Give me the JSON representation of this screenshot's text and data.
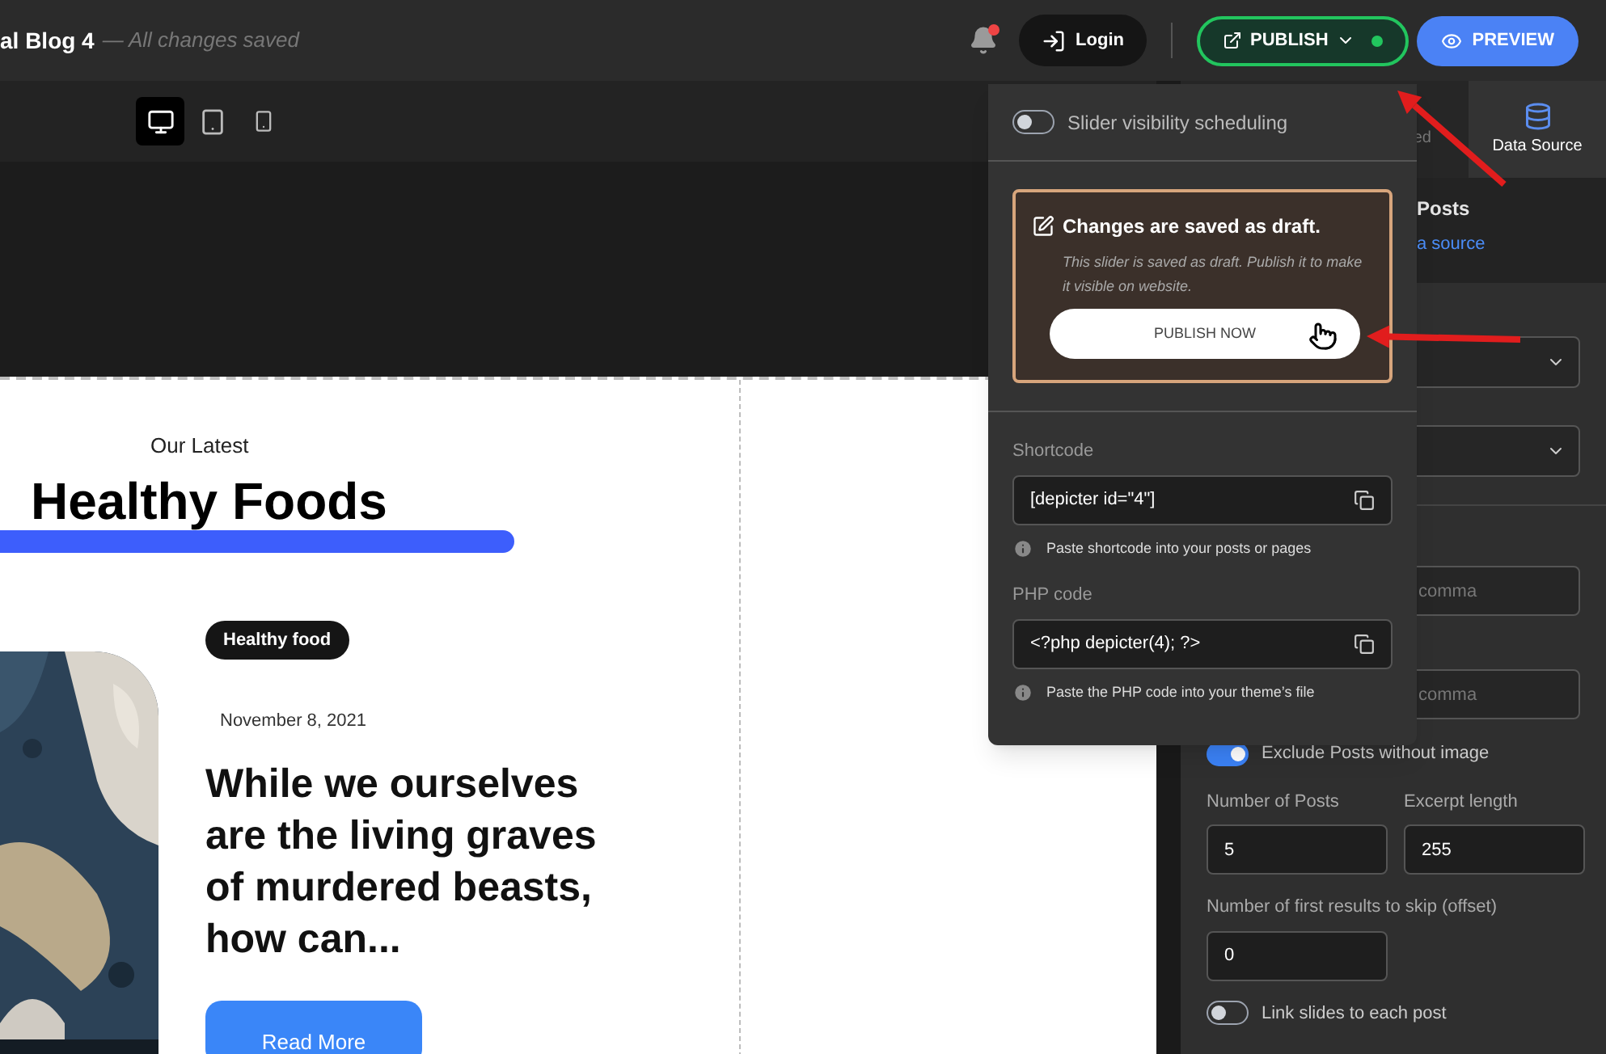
{
  "header": {
    "title": "al Blog 4",
    "save_status": "— All changes saved",
    "login": "Login",
    "publish": "PUBLISH",
    "preview": "PREVIEW"
  },
  "devices": [
    {
      "kind": "desktop",
      "selected": true
    },
    {
      "kind": "tablet",
      "selected": false
    },
    {
      "kind": "mobile",
      "selected": false
    }
  ],
  "canvas": {
    "eyebrow": "Our Latest",
    "heading": "Healthy Foods",
    "post": {
      "tag": "Healthy food",
      "date": "November 8, 2021",
      "title": "While we ourselves are the living graves of murdered beasts, how can...",
      "button": "Read More"
    }
  },
  "publish_menu": {
    "scheduling": {
      "label": "Slider visibility scheduling",
      "on": false
    },
    "draft": {
      "title": "Changes are saved as draft.",
      "text": "This slider is saved as draft. Publish it to make it visible on website.",
      "button": "PUBLISH NOW"
    },
    "fields": [
      {
        "label": "Shortcode",
        "value": "[depicter id=\"4\"]",
        "hint": "Paste shortcode into your posts or pages"
      },
      {
        "label": "PHP code",
        "value": "<?php depicter(4); ?>",
        "hint": "Paste the PHP code into your theme’s file"
      }
    ]
  },
  "sidebar": {
    "tabs": [
      {
        "label": "ed",
        "selected": false
      },
      {
        "label": "Data Source",
        "selected": true
      }
    ],
    "source_title": "Posts",
    "source_link": "a source",
    "filter_inputs": [
      {
        "placeholder": "comma"
      },
      {
        "placeholder": "comma"
      }
    ],
    "exclude_without_image": {
      "label": "Exclude Posts without image",
      "on": true
    },
    "number_of_posts": {
      "label": "Number of Posts",
      "value": "5"
    },
    "excerpt_length": {
      "label": "Excerpt length",
      "value": "255"
    },
    "offset": {
      "label": "Number of first results to skip (offset)",
      "value": "0"
    },
    "link_slides": {
      "label": "Link slides to each post",
      "on": false
    }
  },
  "annotations": [
    {
      "kind": "arrow"
    },
    {
      "kind": "arrow"
    }
  ]
}
